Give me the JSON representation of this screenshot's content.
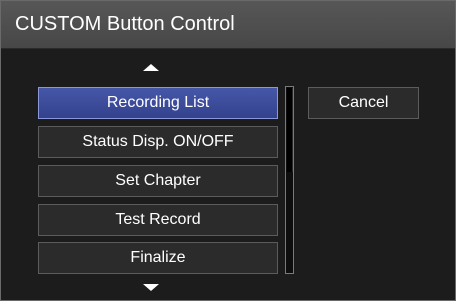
{
  "window": {
    "title": "CUSTOM Button Control"
  },
  "menu": {
    "items": [
      {
        "label": "Recording List",
        "selected": true
      },
      {
        "label": "Status Disp. ON/OFF",
        "selected": false
      },
      {
        "label": "Set Chapter",
        "selected": false
      },
      {
        "label": "Test Record",
        "selected": false
      },
      {
        "label": "Finalize",
        "selected": false
      }
    ],
    "scroll_up_icon": "triangle-up",
    "scroll_down_icon": "triangle-down"
  },
  "actions": {
    "cancel_label": "Cancel"
  },
  "colors": {
    "titlebar": "#4f4f4f",
    "background": "#1c1c1c",
    "selected": "#3e4c9c",
    "button": "#2b2b2b",
    "text": "#ffffff"
  }
}
